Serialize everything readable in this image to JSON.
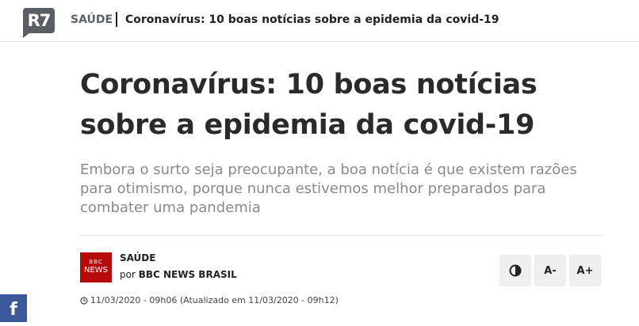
{
  "header": {
    "logo_text": "R7",
    "section": "SAÚDE",
    "article_title": "Coronavírus: 10 boas notícias sobre a epidemia da covid-19"
  },
  "article": {
    "title": "Coronavírus: 10 boas notícias sobre a epidemia da covid-19",
    "subtitle": "Embora o surto seja preocupante, a boa notícia é que existem razões para otimismo, porque nunca estivemos melhor preparados para combater uma pandemia",
    "category": "SAÚDE",
    "byline_prefix": "por",
    "source": "BBC NEWS BRASIL",
    "source_logo_top": "BBC",
    "source_logo_bottom": "NEWS",
    "timestamp": "11/03/2020 - 09h06 (Atualizado em 11/03/2020 - 09h12)"
  },
  "toolbar": {
    "contrast_icon": "contrast-icon",
    "decrease_font_label": "A-",
    "increase_font_label": "A+"
  },
  "social": {
    "facebook_icon": "facebook-icon",
    "facebook_glyph": "f"
  },
  "colors": {
    "logo_gray": "#5a5f66",
    "bbc_red": "#b70b0b",
    "facebook_blue": "#3b5998"
  }
}
